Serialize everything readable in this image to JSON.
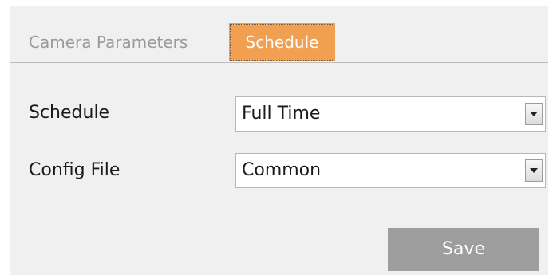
{
  "tabs": [
    {
      "label": "Camera Parameters",
      "active": false
    },
    {
      "label": "Schedule",
      "active": true
    }
  ],
  "form": {
    "schedule": {
      "label": "Schedule",
      "value": "Full Time"
    },
    "config_file": {
      "label": "Config File",
      "value": "Common"
    }
  },
  "actions": {
    "save_label": "Save"
  },
  "colors": {
    "active_tab": "#f0a050",
    "panel_bg": "#f0f0f0",
    "button_bg": "#9e9e9e"
  },
  "icons": {
    "dropdown": "chevron-down-icon"
  }
}
